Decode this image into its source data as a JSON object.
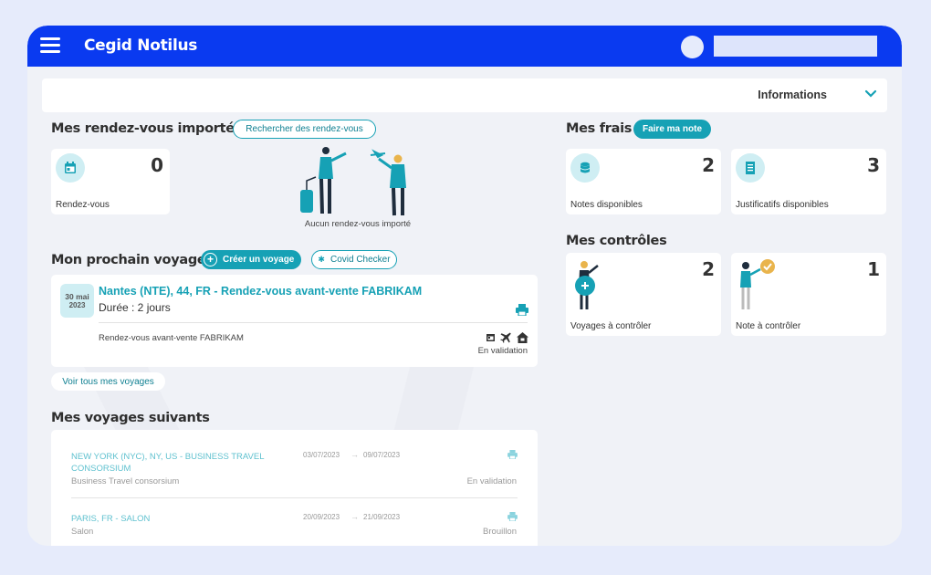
{
  "app": {
    "title": "Cegid Notilus"
  },
  "info_bar": {
    "label": "Informations"
  },
  "rdv": {
    "heading": "Mes rendez-vous importés",
    "search_button": "Rechercher des rendez-vous",
    "card": {
      "count": "0",
      "label": "Rendez-vous"
    },
    "empty_caption": "Aucun rendez-vous importé"
  },
  "next_trip": {
    "heading": "Mon prochain voyage",
    "create_button": "Créer un voyage",
    "covid_button": "Covid Checker",
    "date_day": "30 mai",
    "date_year": "2023",
    "title": "Nantes (NTE), 44, FR - Rendez-vous avant-vente FABRIKAM",
    "duration": "Durée : 2 jours",
    "subtitle": "Rendez-vous avant-vente FABRIKAM",
    "status": "En validation",
    "see_all": "Voir tous mes voyages"
  },
  "next_trips": {
    "heading": "Mes voyages suivants",
    "items": [
      {
        "title": "NEW YORK (NYC), NY, US - BUSINESS TRAVEL CONSORSIUM",
        "subtitle": "Business Travel consorsium",
        "date_from": "03/07/2023",
        "date_to": "09/07/2023",
        "arrow": "→",
        "status": "En validation"
      },
      {
        "title": "PARIS, FR - SALON",
        "subtitle": "Salon",
        "date_from": "20/09/2023",
        "date_to": "21/09/2023",
        "arrow": "→",
        "status": "Brouillon"
      }
    ]
  },
  "frais": {
    "heading": "Mes frais",
    "button": "Faire ma note",
    "cards": [
      {
        "count": "2",
        "label": "Notes disponibles",
        "icon": "coins-icon"
      },
      {
        "count": "3",
        "label": "Justificatifs disponibles",
        "icon": "receipt-icon"
      }
    ]
  },
  "controles": {
    "heading": "Mes contrôles",
    "cards": [
      {
        "count": "2",
        "label": "Voyages à contrôler"
      },
      {
        "count": "1",
        "label": "Note à contrôler"
      }
    ]
  },
  "colors": {
    "brand": "#0a3af0",
    "accent": "#16a1b5",
    "accent_light": "#cfeef3",
    "bg": "#f0f2f7"
  }
}
